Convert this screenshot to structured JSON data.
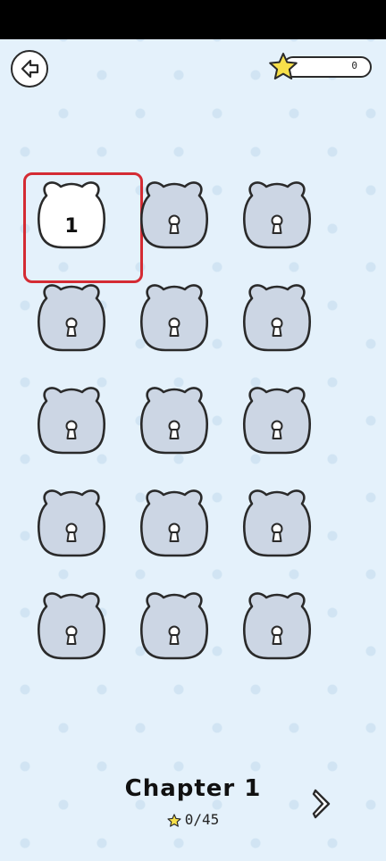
{
  "header": {
    "star_count": "0"
  },
  "levels": [
    {
      "label": "1",
      "locked": false
    },
    {
      "label": "",
      "locked": true
    },
    {
      "label": "",
      "locked": true
    },
    {
      "label": "",
      "locked": true
    },
    {
      "label": "",
      "locked": true
    },
    {
      "label": "",
      "locked": true
    },
    {
      "label": "",
      "locked": true
    },
    {
      "label": "",
      "locked": true
    },
    {
      "label": "",
      "locked": true
    },
    {
      "label": "",
      "locked": true
    },
    {
      "label": "",
      "locked": true
    },
    {
      "label": "",
      "locked": true
    },
    {
      "label": "",
      "locked": true
    },
    {
      "label": "",
      "locked": true
    },
    {
      "label": "",
      "locked": true
    }
  ],
  "footer": {
    "chapter_title": "Chapter 1",
    "progress": "0/45"
  },
  "colors": {
    "background": "#e4f1fb",
    "locked_fill": "#ccd6e4",
    "unlocked_fill": "#ffffff",
    "selected_border": "#d42b33",
    "star": "#f7e04a"
  },
  "icons": {
    "back": "back-arrow-icon",
    "star": "star-icon",
    "lock": "keyhole-icon",
    "next": "chevron-right-icon"
  }
}
